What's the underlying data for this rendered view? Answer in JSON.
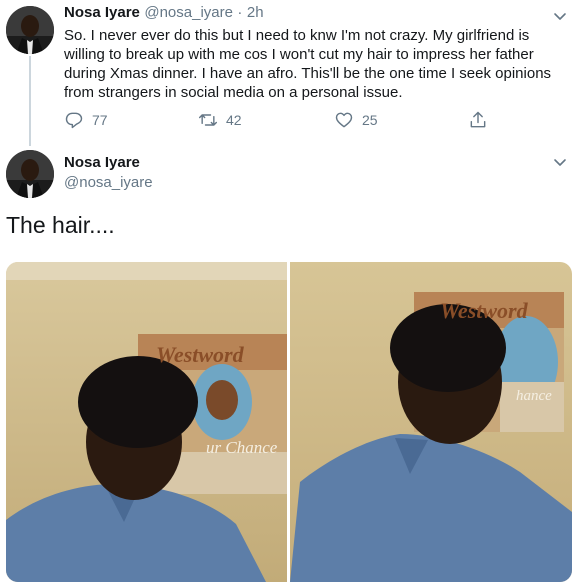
{
  "tweet1": {
    "display_name": "Nosa Iyare",
    "handle": "@nosa_iyare",
    "separator": "·",
    "time": "2h",
    "text": "So. I never ever do this but I need to knw I'm not crazy. My girlfriend is willing to break up with me cos I won't cut my hair to impress her father during Xmas dinner. I have an afro.  This'll be the one time I seek opinions from strangers in social media on a personal issue.",
    "replies": "77",
    "retweets": "42",
    "likes": "25",
    "icons": [
      "reply-icon",
      "retweet-icon",
      "like-icon",
      "share-icon",
      "chevron-down-icon"
    ]
  },
  "tweet2": {
    "display_name": "Nosa Iyare",
    "handle": "@nosa_iyare",
    "text": "The hair....",
    "photo_left_poster_title": "Westword",
    "photo_left_poster_caption": "ur Chance",
    "photo_right_poster_title": "Westword",
    "photo_right_poster_caption": "hance",
    "icons": [
      "chevron-down-icon"
    ]
  },
  "colors": {
    "text": "#14171a",
    "secondary": "#657786",
    "thread_line": "#ccd6dd",
    "wall": "#cdb88a",
    "shirt": "#5d7ea8"
  }
}
